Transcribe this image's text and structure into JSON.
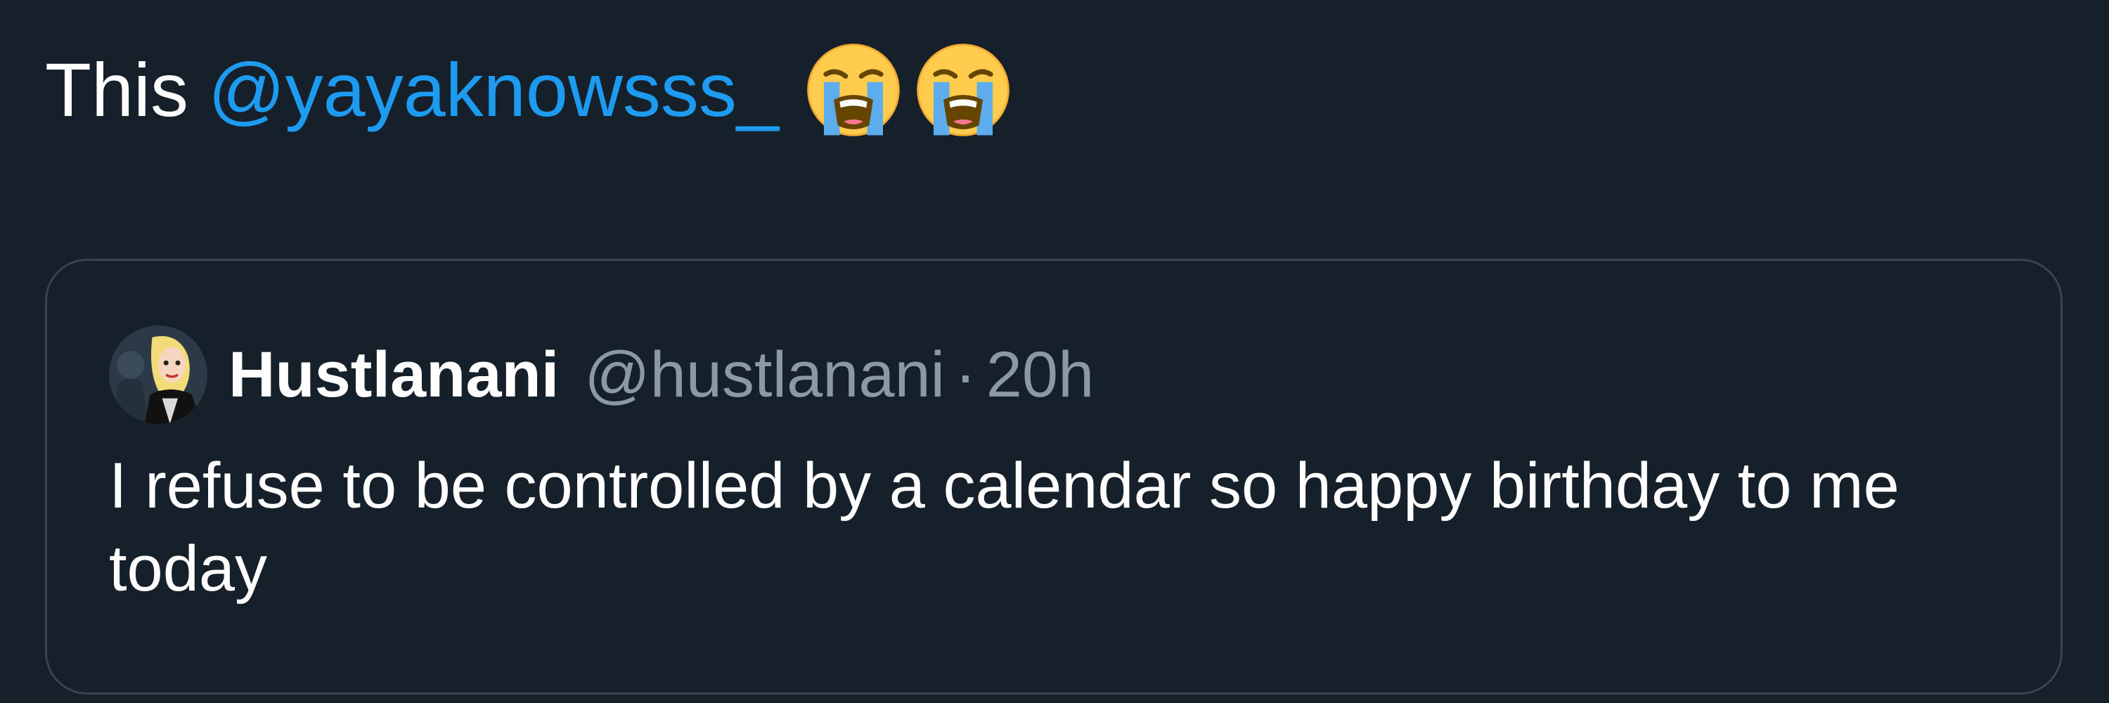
{
  "tweet": {
    "text_start": "This",
    "mention": "@yayaknowsss_",
    "emojis": [
      "loudly-crying-face",
      "loudly-crying-face"
    ]
  },
  "quoted_tweet": {
    "avatar": "user-avatar",
    "display_name": "Hustlanani",
    "handle": "@hustlanani",
    "separator": "·",
    "time": "20h",
    "text": "I refuse to be controlled by a calendar so happy birthday to me today"
  },
  "colors": {
    "background": "#16202b",
    "mention": "#1d9bf0",
    "secondary_text": "#8b98a5",
    "border": "#38444d"
  }
}
